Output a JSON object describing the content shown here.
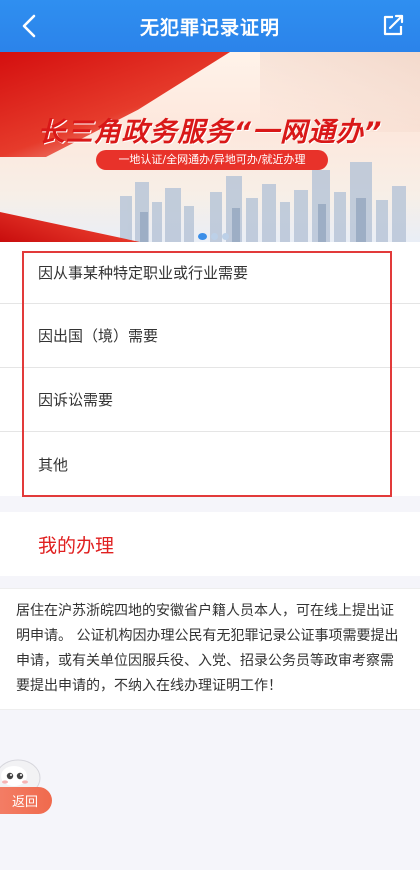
{
  "header": {
    "title": "无犯罪记录证明"
  },
  "banner": {
    "headline": "长三角政务服务“一网通办”",
    "subline": "一地认证/全网通办/异地可办/就近办理",
    "carousel_count": 3,
    "carousel_active_index": 0
  },
  "reasons": [
    {
      "label": "因从事某种特定职业或行业需要"
    },
    {
      "label": "因出国（境）需要"
    },
    {
      "label": "因诉讼需要"
    },
    {
      "label": "其他"
    }
  ],
  "my_section": {
    "title": "我的办理"
  },
  "notice": {
    "text": "居住在沪苏浙皖四地的安徽省户籍人员本人，可在线上提出证明申请。 公证机构因办理公民有无犯罪记录公证事项需要提出申请，或有关单位因服兵役、入党、招录公务员等政审考察需要提出申请的，不纳入在线办理证明工作！"
  },
  "float_button": {
    "label": "返回"
  },
  "colors": {
    "header_blue": "#2b83ea",
    "accent_red": "#e02020"
  }
}
